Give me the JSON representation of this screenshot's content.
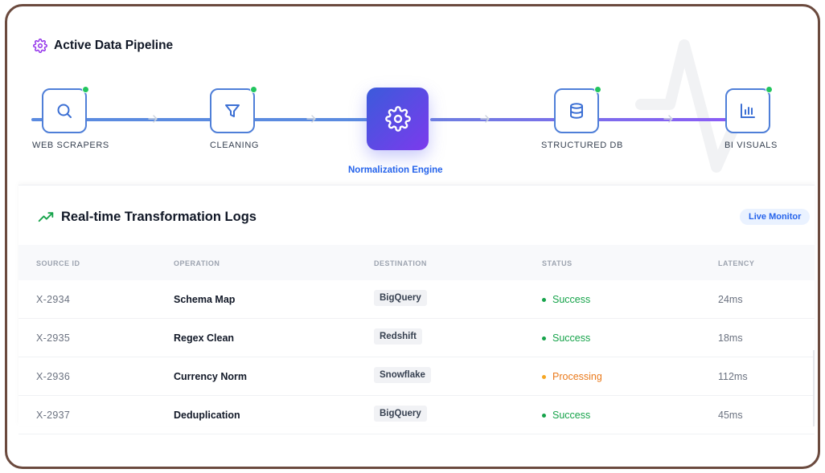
{
  "pipeline": {
    "title": "Active Data Pipeline",
    "nodes": [
      {
        "label": "WEB SCRAPERS",
        "icon": "search-icon",
        "status": "active"
      },
      {
        "label": "CLEANING",
        "icon": "filter-icon",
        "status": "active"
      },
      {
        "label": "STRUCTURED DB",
        "icon": "database-icon",
        "status": "active"
      },
      {
        "label": "BI VISUALS",
        "icon": "bar-chart-icon",
        "status": "active"
      }
    ],
    "engine": {
      "label": "Normalization Engine",
      "icon": "gear-icon"
    }
  },
  "logs": {
    "title": "Real-time Transformation Logs",
    "badge": "Live Monitor",
    "columns": [
      "SOURCE ID",
      "OPERATION",
      "DESTINATION",
      "STATUS",
      "LATENCY"
    ],
    "rows": [
      {
        "id": "X-2934",
        "operation": "Schema Map",
        "destination": "BigQuery",
        "status": "Success",
        "latency": "24ms"
      },
      {
        "id": "X-2935",
        "operation": "Regex Clean",
        "destination": "Redshift",
        "status": "Success",
        "latency": "18ms"
      },
      {
        "id": "X-2936",
        "operation": "Currency Norm",
        "destination": "Snowflake",
        "status": "Processing",
        "latency": "112ms"
      },
      {
        "id": "X-2937",
        "operation": "Deduplication",
        "destination": "BigQuery",
        "status": "Success",
        "latency": "45ms"
      }
    ]
  },
  "colors": {
    "accent": "#2563eb",
    "engine_gradient_start": "#3b5bdb",
    "engine_gradient_end": "#7c3aed",
    "success": "#16a34a",
    "processing": "#ea7a1c",
    "node_border": "#4f7fd8",
    "status_dot_active": "#22c55e"
  }
}
